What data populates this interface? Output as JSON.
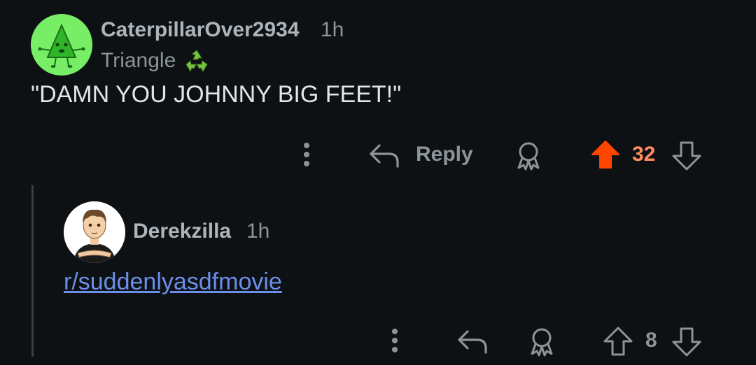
{
  "comment": {
    "username": "CaterpillarOver2934",
    "time": "1h",
    "flair_text": "Triangle",
    "flair_icon": "recycle-icon",
    "body": "\"DAMN YOU JOHNNY BIG FEET!\"",
    "actions": {
      "more_icon": "more-vertical-icon",
      "reply_label": "Reply",
      "award_icon": "award-icon",
      "score": "32",
      "upvoted": true,
      "upvote_color": "#ff4500",
      "score_color": "#ff8b60"
    }
  },
  "reply": {
    "username": "Derekzilla",
    "time": "1h",
    "link": "r/suddenlyasdfmovie",
    "actions": {
      "more_icon": "more-vertical-icon",
      "award_icon": "award-icon",
      "score": "8",
      "upvoted": false
    }
  },
  "colors": {
    "background": "#0d1114",
    "text_muted": "#8c9499",
    "link": "#6b8fea",
    "thread_line": "#3a3f43"
  }
}
